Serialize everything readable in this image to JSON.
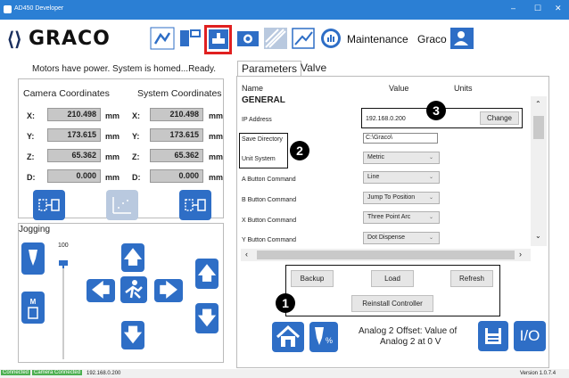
{
  "window": {
    "title": "AD450 Developer",
    "controls": [
      "–",
      "☐",
      "✕"
    ]
  },
  "toolbar": {
    "logo_text": "GRACO",
    "page_label": "Maintenance",
    "user_label": "Graco"
  },
  "status_message": "Motors have power. System is homed...Ready.",
  "coordinates": {
    "camera_title": "Camera Coordinates",
    "system_title": "System Coordinates",
    "unit": "mm",
    "rows": [
      {
        "axis": "X:",
        "camera": "210.498",
        "system": "210.498"
      },
      {
        "axis": "Y:",
        "camera": "173.615",
        "system": "173.615"
      },
      {
        "axis": "Z:",
        "camera": "65.362",
        "system": "65.362"
      },
      {
        "axis": "D:",
        "camera": "0.000",
        "system": "0.000"
      }
    ]
  },
  "jogging": {
    "title": "Jogging",
    "speed_value": "100"
  },
  "parameters": {
    "tabs": [
      "Parameters",
      "Valve"
    ],
    "headers": {
      "name": "Name",
      "value": "Value",
      "units": "Units"
    },
    "section": "GENERAL",
    "rows": [
      {
        "name": "IP Address",
        "value": "192.168.0.200",
        "kind": "text"
      },
      {
        "name": "Save Directory",
        "value": "C:\\Graco\\",
        "kind": "text"
      },
      {
        "name": "Unit System",
        "value": "Metric",
        "kind": "select"
      },
      {
        "name": "A Button Command",
        "value": "Line",
        "kind": "select"
      },
      {
        "name": "B Button Command",
        "value": "Jump To Position",
        "kind": "select"
      },
      {
        "name": "X Button Command",
        "value": "Three Point Arc",
        "kind": "select"
      },
      {
        "name": "Y Button Command",
        "value": "Dot Dispense",
        "kind": "select"
      }
    ],
    "change_label": "Change",
    "buttons": {
      "backup": "Backup",
      "load": "Load",
      "refresh": "Refresh",
      "reinstall": "Reinstall Controller"
    }
  },
  "callouts": [
    "1",
    "2",
    "3"
  ],
  "analog": {
    "line1": "Analog 2 Offset: Value of",
    "line2": "Analog 2 at 0 V"
  },
  "io_label": "I/O",
  "statusbar": {
    "connected": "Connected",
    "camera": "Camera Connected",
    "ip": "192.168.0.200",
    "version": "Version 1.0.7.4"
  },
  "colors": {
    "titlebar": "#2b7fd4",
    "button_blue": "#2e6ec6",
    "highlight": "#e02020",
    "connected": "#4caf50"
  }
}
